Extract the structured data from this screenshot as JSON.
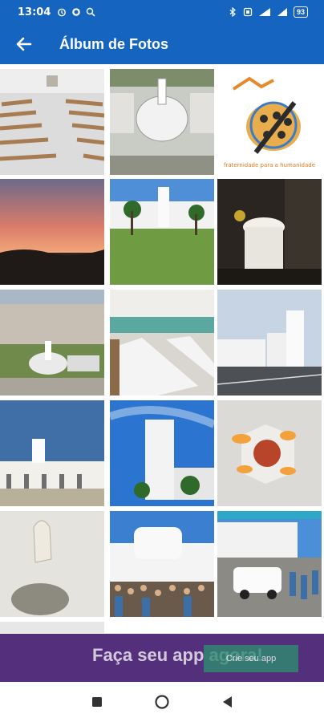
{
  "status_bar": {
    "time": "13:04",
    "battery": "93"
  },
  "app_bar": {
    "title": "Álbum de Fotos",
    "back_icon": "arrow-left-icon"
  },
  "photos": [
    {
      "name": "church-interior-pews"
    },
    {
      "name": "church-aerial-view"
    },
    {
      "name": "parish-logo",
      "caption": "fraternidade para a humanidade"
    },
    {
      "name": "sunset-sky"
    },
    {
      "name": "church-lawn-trees"
    },
    {
      "name": "altar-candle-dark"
    },
    {
      "name": "town-aerial-view"
    },
    {
      "name": "dining-hall-tables"
    },
    {
      "name": "church-street-view"
    },
    {
      "name": "church-building-blue-sky"
    },
    {
      "name": "bell-tower-trees"
    },
    {
      "name": "lit-wall-fixture"
    },
    {
      "name": "white-sculpture"
    },
    {
      "name": "outdoor-mass-crowd"
    },
    {
      "name": "car-crowd-event"
    }
  ],
  "ad_banner": {
    "text": "Faça seu app agora!",
    "button": "Crie seu app"
  },
  "nav_bar": {
    "icons": [
      "square-icon",
      "circle-home-icon",
      "triangle-back-icon"
    ]
  },
  "colors": {
    "primary": "#1565c0",
    "banner": "#54307c",
    "banner_button": "#2f8c72"
  }
}
